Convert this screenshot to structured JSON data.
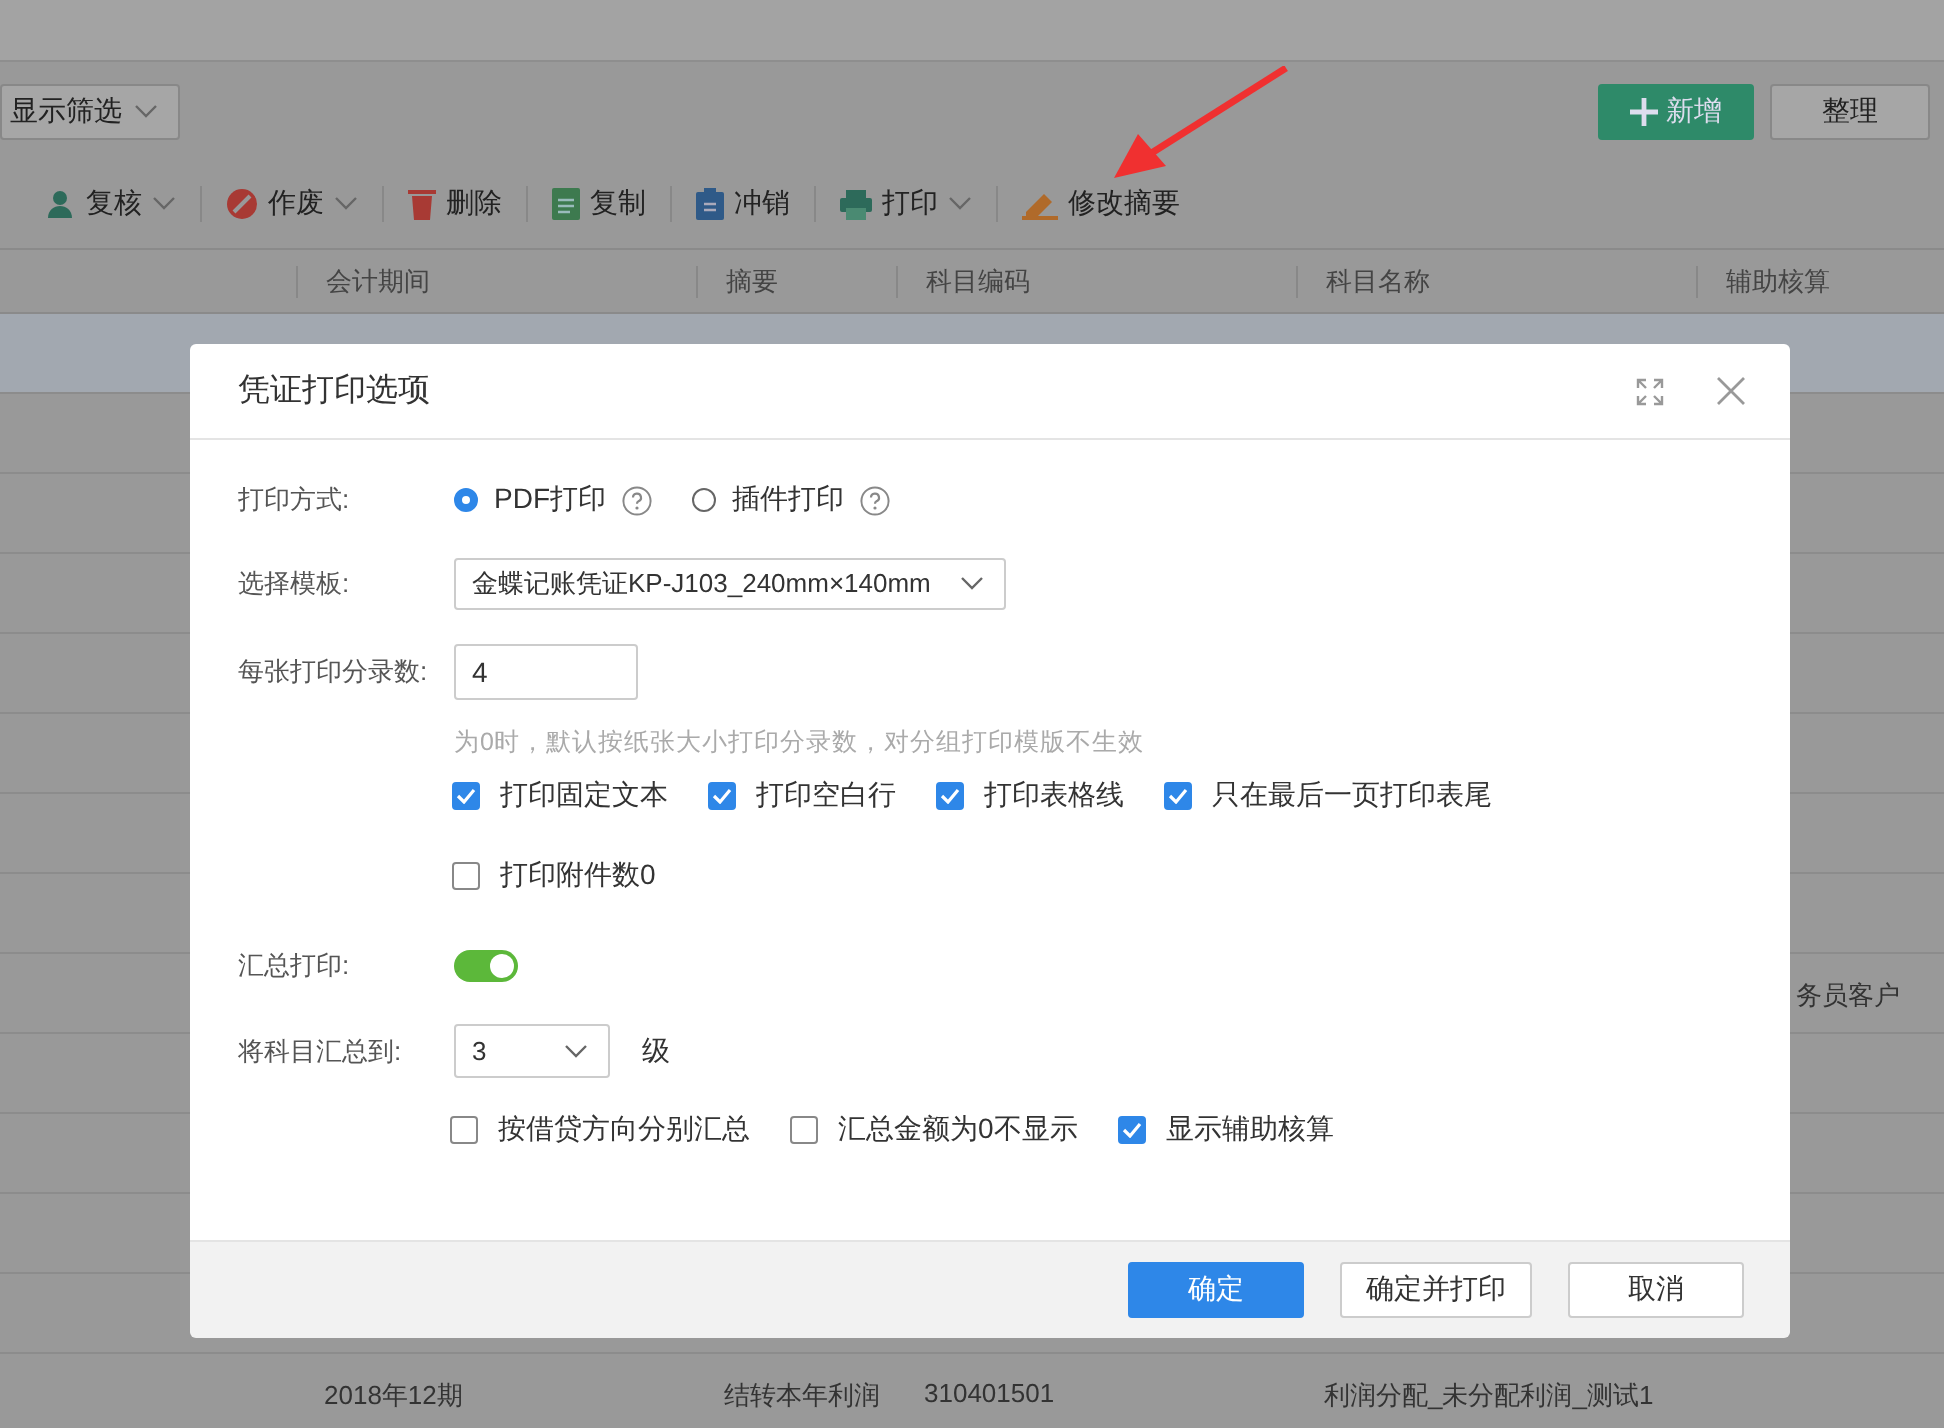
{
  "page": {
    "filter_button": "显示筛选",
    "add_button": "新增",
    "tidy_button": "整理",
    "toolbar": [
      {
        "label": "复核",
        "dropdown": true
      },
      {
        "label": "作废",
        "dropdown": true
      },
      {
        "label": "删除",
        "dropdown": false
      },
      {
        "label": "复制",
        "dropdown": false
      },
      {
        "label": "冲销",
        "dropdown": false
      },
      {
        "label": "打印",
        "dropdown": true
      },
      {
        "label": "修改摘要",
        "dropdown": false
      }
    ],
    "table": {
      "columns": [
        "会计期间",
        "摘要",
        "科目编码",
        "科目名称",
        "辅助核算"
      ],
      "rows": [
        {
          "selected": true
        },
        {
          "selected": false
        },
        {
          "selected": false
        },
        {
          "selected": false
        },
        {
          "selected": false
        },
        {
          "selected": false
        },
        {
          "selected": false
        },
        {
          "selected": false
        },
        {
          "selected": false,
          "auxiliary": "务员客户"
        },
        {
          "selected": false
        },
        {
          "selected": false
        },
        {
          "selected": false
        },
        {
          "selected": false
        },
        {
          "selected": false,
          "period": "2018年12期",
          "summary": "结转本年利润",
          "account_code": "310401501",
          "account_name": "利润分配_未分配利润_测试1"
        }
      ]
    }
  },
  "dialog": {
    "title": "凭证打印选项",
    "print_mode": {
      "label": "打印方式:",
      "options": [
        {
          "label": "PDF打印",
          "selected": true
        },
        {
          "label": "插件打印",
          "selected": false
        }
      ]
    },
    "template": {
      "label": "选择模板:",
      "value": "金蝶记账凭证KP-J103_240mm×140mm"
    },
    "entries_per_sheet": {
      "label": "每张打印分录数:",
      "value": "4",
      "hint": "为0时，默认按纸张大小打印分录数，对分组打印模版不生效"
    },
    "print_options": [
      {
        "label": "打印固定文本",
        "checked": true
      },
      {
        "label": "打印空白行",
        "checked": true
      },
      {
        "label": "打印表格线",
        "checked": true
      },
      {
        "label": "只在最后一页打印表尾",
        "checked": true
      },
      {
        "label": "打印附件数0",
        "checked": false
      }
    ],
    "summary_print": {
      "label": "汇总打印:",
      "on": true
    },
    "summary_level": {
      "label": "将科目汇总到:",
      "value": "3",
      "unit": "级"
    },
    "summary_options": [
      {
        "label": "按借贷方向分别汇总",
        "checked": false
      },
      {
        "label": "汇总金额为0不显示",
        "checked": false
      },
      {
        "label": "显示辅助核算",
        "checked": true
      }
    ],
    "buttons": [
      {
        "label": "确定",
        "kind": "primary"
      },
      {
        "label": "确定并打印",
        "kind": "default"
      },
      {
        "label": "取消",
        "kind": "default"
      }
    ]
  }
}
